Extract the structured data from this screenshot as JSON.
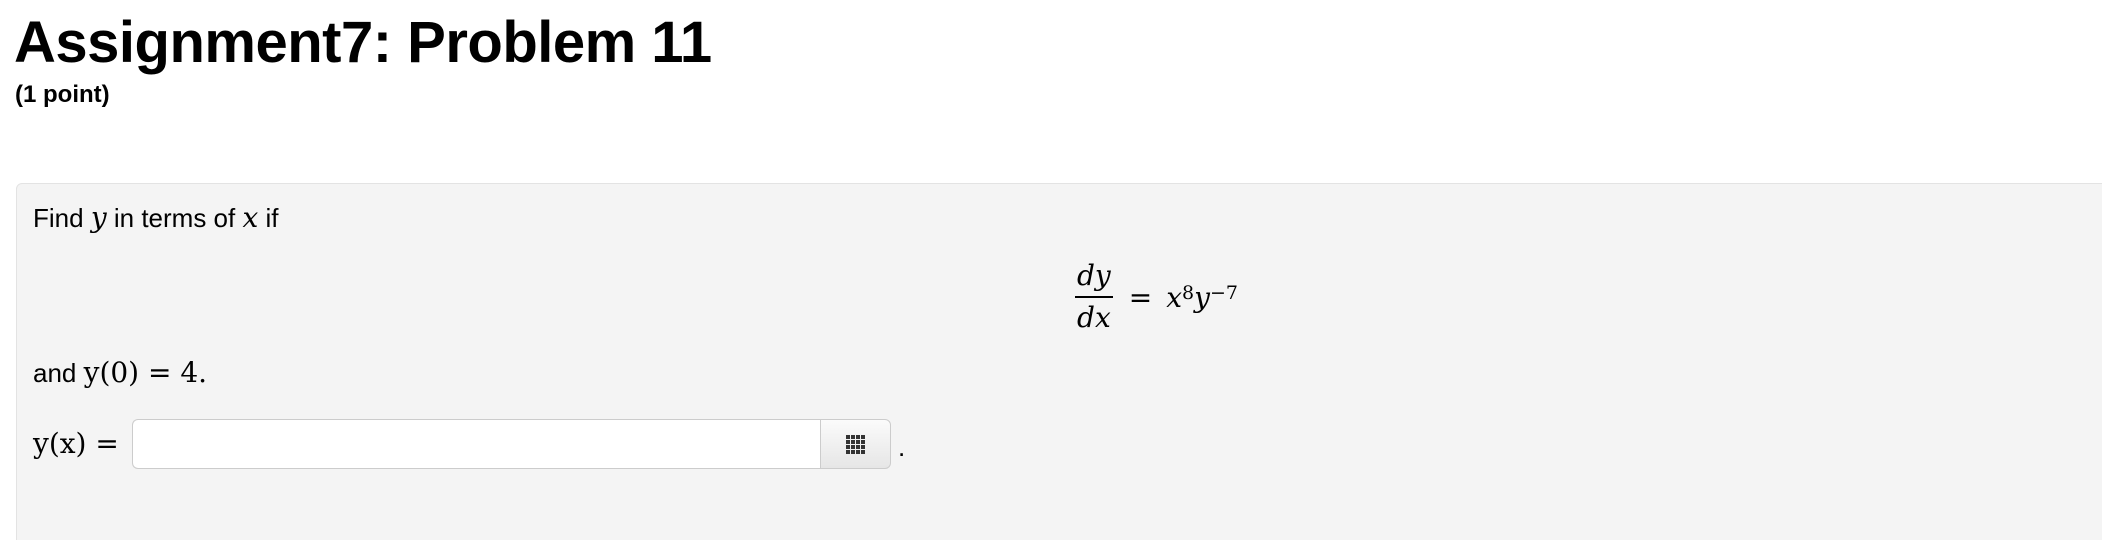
{
  "header": {
    "title": "Assignment7: Problem 11",
    "points": "(1 point)"
  },
  "problem": {
    "intro_prefix": "Find",
    "intro_var_y": "y",
    "intro_middle": "in terms of",
    "intro_var_x": "x",
    "intro_suffix": "if",
    "equation": {
      "numerator": "dy",
      "denominator": "dx",
      "equals": "=",
      "rhs_x": "x",
      "rhs_x_exponent": "8",
      "rhs_y": "y",
      "rhs_y_exponent": "−7"
    },
    "condition_prefix": "and",
    "condition_math": "y(0) = 4.",
    "answer_label": "y(x) =",
    "answer_value": "",
    "answer_placeholder": "",
    "trailing_period": "."
  },
  "icons": {
    "palette_button": "grid-icon"
  },
  "colors": {
    "problem_background": "#f4f4f4",
    "border": "#cccccc"
  }
}
